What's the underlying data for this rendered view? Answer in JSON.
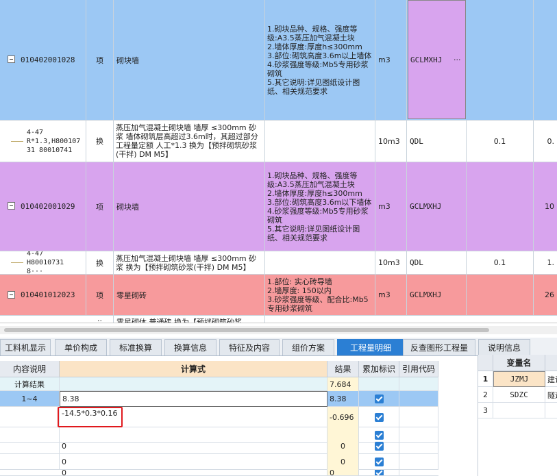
{
  "top_rows": [
    {
      "code": "010402001028",
      "type": "项",
      "name": "砌块墙",
      "features": "1.砌块品种、规格、强度等级:A3.5蒸压加气混凝土块\n2.墙体厚度:厚度h≤300mm\n3.部位:砌筑高度3.6m以上墙体\n4.砂浆强度等级:Mb5专用砂浆砌筑\n5.其它说明:详见图纸设计图纸、相关规范要求",
      "unit": "m3",
      "expr": "GCLMXHJ",
      "ellipsis": "···",
      "qty": "",
      "last": ""
    },
    {
      "code": "4-47 R*1.3,H800107 31 80010741",
      "type": "换",
      "name": "蒸压加气混凝土砌块墙 墙厚 ≤300mm 砂浆  墙体砌筑层高超过3.6m时，其超过部分工程量定额 人工*1.3  换为【预拌砌筑砂浆(干拌) DM M5】",
      "features": "",
      "unit": "10m3",
      "expr": "QDL",
      "qty": "0.1",
      "last": "0."
    },
    {
      "code": "010402001029",
      "type": "项",
      "name": "砌块墙",
      "features": "1.砌块品种、规格、强度等级:A3.5蒸压加气混凝土块\n2.墙体厚度:厚度h≤300mm\n3.部位:砌筑高度3.6m以下墙体\n4.砂浆强度等级:Mb5专用砂浆砌筑\n5.其它说明:详见图纸设计图纸、相关规范要求",
      "unit": "m3",
      "expr": "GCLMXHJ",
      "qty": "",
      "last": "10"
    },
    {
      "code": "4-47 H80010731 8···",
      "type": "换",
      "name": "蒸压加气混凝土砌块墙 墙厚 ≤300mm 砂浆  换为【预拌砌筑砂浆(干拌) DM M5】",
      "features": "",
      "unit": "10m3",
      "expr": "QDL",
      "qty": "0.1",
      "last": "1."
    },
    {
      "code": "010401012023",
      "type": "项",
      "name": "零星砌砖",
      "features": "1.部位: 实心砖导墙\n2.墙厚度: 150以内\n3.砂浆强度等级、配合比:Mb5专用砂浆砌筑",
      "unit": "m3",
      "expr": "GCLMXHJ",
      "qty": "",
      "last": "26"
    },
    {
      "code": "",
      "type": "··",
      "name": "零星砌体 普通砖  换为【预拌砌筑砂浆",
      "features": "",
      "unit": "",
      "expr": "",
      "qty": "",
      "last": ""
    }
  ],
  "tabs": [
    {
      "label": "工料机显示"
    },
    {
      "label": "单价构成"
    },
    {
      "label": "标准换算"
    },
    {
      "label": "换算信息"
    },
    {
      "label": "特征及内容"
    },
    {
      "label": "组价方案"
    },
    {
      "label": "工程量明细"
    },
    {
      "label": "反查图形工程量"
    },
    {
      "label": "说明信息"
    }
  ],
  "detail": {
    "headers": {
      "desc": "内容说明",
      "formula": "计算式",
      "result": "结果",
      "flag": "累加标识",
      "ref": "引用代码"
    },
    "rows": [
      {
        "desc": "计算结果",
        "formula": "",
        "result": "7.684",
        "checked": false
      },
      {
        "desc": "1~4",
        "formula": "8.38",
        "result": "8.38",
        "checked": true
      },
      {
        "desc": "",
        "formula": "-14.5*0.3*0.16",
        "result": "-0.696",
        "checked": true
      },
      {
        "desc": "",
        "formula": "",
        "result": "",
        "checked": true
      },
      {
        "desc": "",
        "formula": "0",
        "result": "0",
        "checked": true
      },
      {
        "desc": "",
        "formula": "0",
        "result": "0",
        "checked": true
      },
      {
        "desc": "",
        "formula": "0",
        "result": "0",
        "checked": true
      }
    ]
  },
  "vars": {
    "header": "变量名",
    "rows": [
      {
        "num": "1",
        "name": "JZMJ",
        "extra": "建设"
      },
      {
        "num": "2",
        "name": "SDZC",
        "extra": "隧道"
      },
      {
        "num": "3",
        "name": "",
        "extra": ""
      }
    ]
  },
  "colors": {
    "blue_row": "#9cc8f4",
    "purple_row": "#d8a4ee",
    "red_row": "#f79a9c",
    "tab_active": "#2b7fd4",
    "highlight": "#e0191d"
  }
}
